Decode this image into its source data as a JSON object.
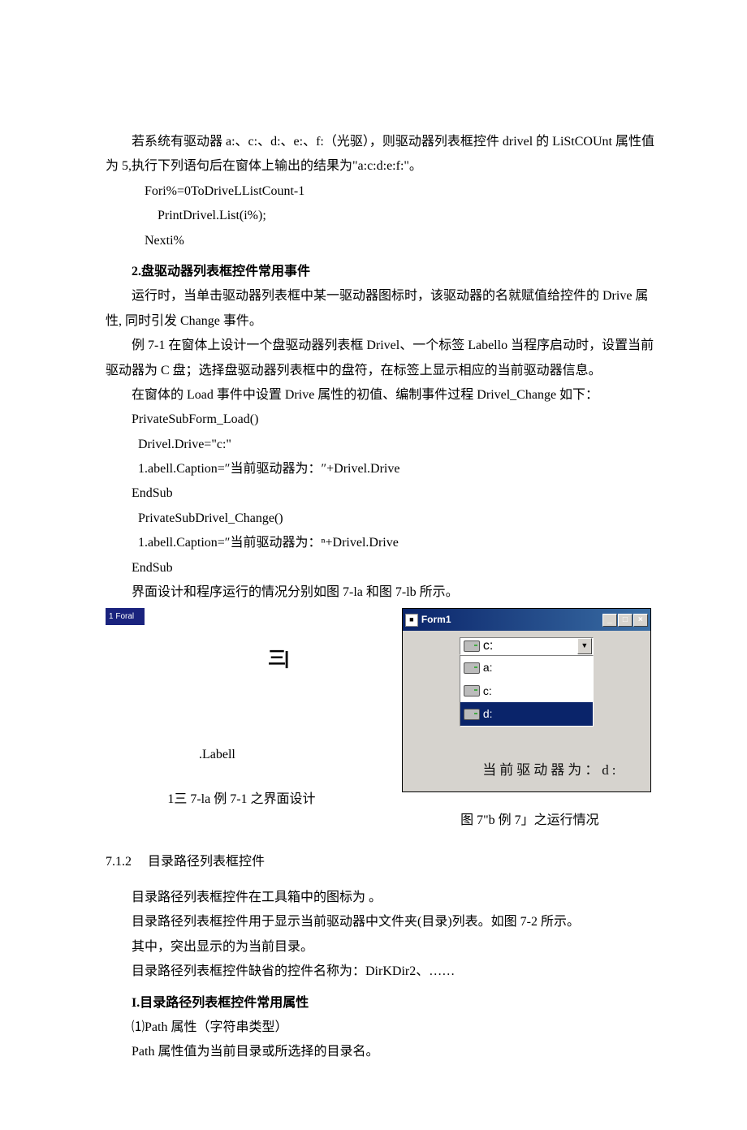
{
  "para1": "若系统有驱动器 a:、c:、d:、e:、f:（光驱），则驱动器列表框控件 drivel 的 LiStCOUnt 属性值为 5,执行下列语句后在窗体上输出的结果为\"a:c:d:e:f:\"。",
  "code1_l1": "Fori%=0ToDriveLListCount-1",
  "code1_l2": "PrintDrivel.List(i%);",
  "code1_l3": "Nexti%",
  "h2_1": "2.盘驱动器列表框控件常用事件",
  "para2": "运行时，当单击驱动器列表框中某一驱动器图标时，该驱动器的名就赋值给控件的 Drive 属性, 同时引发 Change 事件。",
  "para3": "例 7-1 在窗体上设计一个盘驱动器列表框 Drivel、一个标签 Labello 当程序启动时，设置当前驱动器为 C 盘；选择盘驱动器列表框中的盘符，在标签上显示相应的当前驱动器信息。",
  "para4": "在窗体的 Load 事件中设置 Drive 属性的初值、编制事件过程 Drivel_Change 如下：",
  "code2_l1": "PrivateSubForm_Load()",
  "code2_l2": "Drivel.Drive=\"c:\"",
  "code2_l3": "1.abell.Caption=″当前驱动器为：″+Drivel.Drive",
  "code2_l4": "EndSub",
  "code2_l5": "PrivateSubDrivel_Change()",
  "code2_l6": "1.abell.Caption=″当前驱动器为：ⁿ+Drivel.Drive",
  "code2_l7": "EndSub",
  "para5": "界面设计和程序运行的情况分别如图 7-la 和图 7-lb 所示。",
  "fig_left_title": "1 Foral",
  "fig_left_hamburger": "三|",
  "fig_left_label": ".Labell",
  "fig_left_caption": "1三 7-la 例 7-1 之界面设计",
  "fig_right_title": "Form1",
  "fig_right_drives": {
    "selected": "c:",
    "items": [
      "a:",
      "c:",
      "d:"
    ],
    "highlighted": "d:"
  },
  "fig_right_status": "当前驱动器为：d:",
  "fig_right_caption": "图 7\"b 例 7」之运行情况",
  "sec712_num": "7.1.2",
  "sec712_title": "目录路径列表框控件",
  "para6": "目录路径列表框控件在工具箱中的图标为    。",
  "para7": "目录路径列表框控件用于显示当前驱动器中文件夹(目录)列表。如图 7-2 所示。",
  "para8": "其中，突出显示的为当前目录。",
  "para9": "目录路径列表框控件缺省的控件名称为：DirKDir2、……",
  "h2_2": "I.目录路径列表框控件常用属性",
  "para10": "⑴Path 属性（字符串类型）",
  "para11": "Path 属性值为当前目录或所选择的目录名。"
}
